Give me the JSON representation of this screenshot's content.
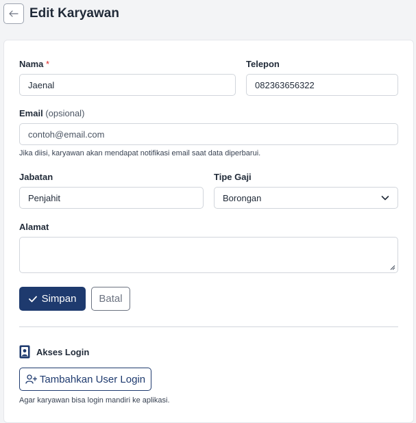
{
  "header": {
    "back_icon": "arrow-left-icon",
    "title": "Edit Karyawan"
  },
  "form": {
    "nama": {
      "label": "Nama",
      "required_mark": "*",
      "value": "Jaenal"
    },
    "telepon": {
      "label": "Telepon",
      "value": "082363656322"
    },
    "email": {
      "label": "Email",
      "optional_label": "(opsional)",
      "value": "",
      "placeholder": "contoh@email.com",
      "hint": "Jika diisi, karyawan akan mendapat notifikasi email saat data diperbarui."
    },
    "jabatan": {
      "label": "Jabatan",
      "value": "Penjahit"
    },
    "tipe_gaji": {
      "label": "Tipe Gaji",
      "selected": "Borongan"
    },
    "alamat": {
      "label": "Alamat",
      "value": ""
    },
    "save_label": "Simpan",
    "save_icon": "check-icon",
    "cancel_label": "Batal"
  },
  "login": {
    "icon": "id-badge-icon",
    "title": "Akses Login",
    "add_label": "Tambahkan User Login",
    "add_icon": "user-plus-icon",
    "hint": "Agar karyawan bisa login mandiri ke aplikasi."
  },
  "colors": {
    "primary": "#1e3a6e",
    "required": "#dc2626",
    "background": "#f3f4f6"
  }
}
